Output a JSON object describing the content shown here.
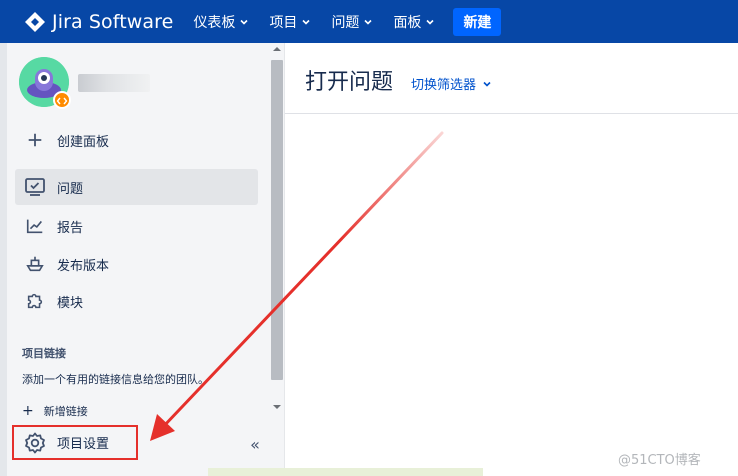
{
  "app": {
    "logo_text": "Jira Software"
  },
  "nav": {
    "items": [
      {
        "label": "仪表板"
      },
      {
        "label": "项目"
      },
      {
        "label": "问题"
      },
      {
        "label": "面板"
      }
    ],
    "create_label": "新建"
  },
  "sidebar": {
    "items": [
      {
        "label": "创建面板",
        "icon": "plus-icon"
      },
      {
        "label": "问题",
        "icon": "issues-icon",
        "active": true
      },
      {
        "label": "报告",
        "icon": "chart-icon"
      },
      {
        "label": "发布版本",
        "icon": "ship-icon"
      },
      {
        "label": "模块",
        "icon": "puzzle-icon"
      }
    ],
    "links_section": {
      "title": "项目链接",
      "description": "添加一个有用的链接信息给您的团队。",
      "add_label": "新增链接"
    },
    "settings_label": "项目设置",
    "collapse_label": "«"
  },
  "main": {
    "title": "打开问题",
    "switch_filter_label": "切换筛选器"
  },
  "watermark": "@51CTO博客",
  "colors": {
    "topbar": "#0747a6",
    "create_button": "#0065ff",
    "annotation": "#e5302b"
  }
}
